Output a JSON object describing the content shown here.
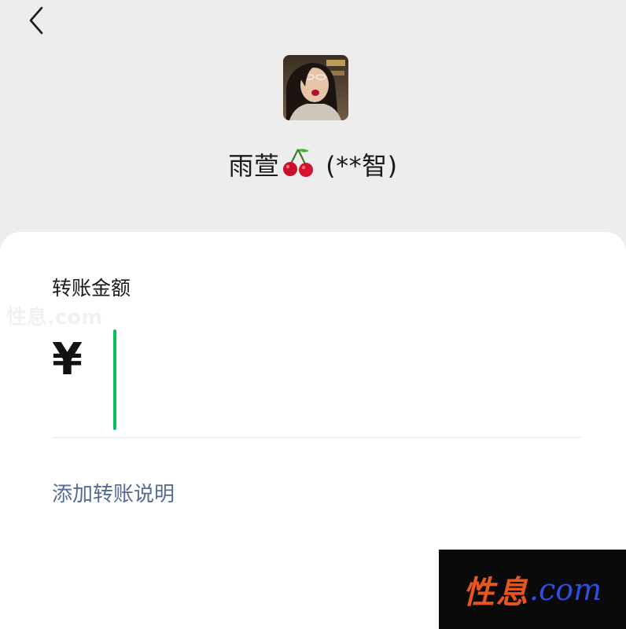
{
  "header": {
    "back_icon": "chevron-left-icon"
  },
  "payee": {
    "avatar": "profile-photo",
    "nickname": "雨萱",
    "emoji": "cherry",
    "masked_real_name": "(**智)"
  },
  "transfer": {
    "amount_label": "转账金额",
    "currency_symbol": "¥",
    "amount_value": "",
    "add_note_label": "添加转账说明"
  },
  "watermark": {
    "faint_text": "性息.com",
    "text_cn": "性息",
    "text_en": ".com"
  },
  "colors": {
    "caret": "#07c160",
    "link": "#576b95",
    "background": "#ededed",
    "card": "#ffffff"
  }
}
